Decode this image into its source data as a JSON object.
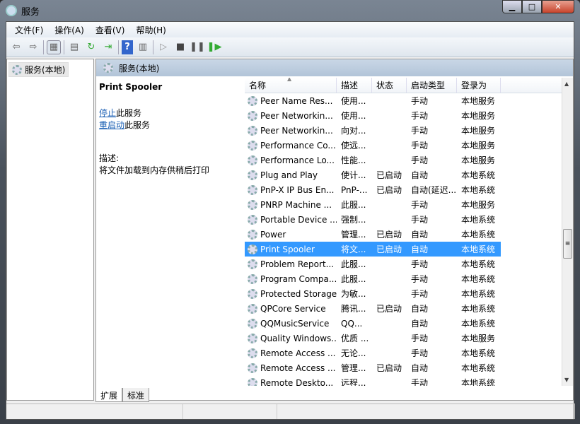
{
  "window": {
    "title": "服务"
  },
  "menu": [
    "文件(F)",
    "操作(A)",
    "查看(V)",
    "帮助(H)"
  ],
  "toolbar": [
    "back-icon",
    "forward-icon",
    "show-hide-tree-icon",
    "properties-icon",
    "refresh-icon",
    "export-icon",
    "help-icon",
    "action-pane-icon",
    "start-icon",
    "stop-icon",
    "pause-icon",
    "restart-icon"
  ],
  "tree": {
    "root": "服务(本地)"
  },
  "pane": {
    "header": "服务(本地)",
    "selected_name": "Print Spooler",
    "stop_link": "停止",
    "stop_suffix": "此服务",
    "restart_link": "重启动",
    "restart_suffix": "此服务",
    "desc_label": "描述:",
    "desc_text": "将文件加载到内存供稍后打印"
  },
  "columns": [
    "名称",
    "描述",
    "状态",
    "启动类型",
    "登录为"
  ],
  "rows": [
    [
      "Peer Name Res...",
      "使用...",
      "",
      "手动",
      "本地服务"
    ],
    [
      "Peer Networkin...",
      "使用...",
      "",
      "手动",
      "本地服务"
    ],
    [
      "Peer Networkin...",
      "向对...",
      "",
      "手动",
      "本地服务"
    ],
    [
      "Performance Co...",
      "使远...",
      "",
      "手动",
      "本地服务"
    ],
    [
      "Performance Lo...",
      "性能...",
      "",
      "手动",
      "本地服务"
    ],
    [
      "Plug and Play",
      "使计...",
      "已启动",
      "自动",
      "本地系统"
    ],
    [
      "PnP-X IP Bus En...",
      "PnP-...",
      "已启动",
      "自动(延迟...",
      "本地系统"
    ],
    [
      "PNRP Machine ...",
      "此服...",
      "",
      "手动",
      "本地服务"
    ],
    [
      "Portable Device ...",
      "强制...",
      "",
      "手动",
      "本地系统"
    ],
    [
      "Power",
      "管理...",
      "已启动",
      "自动",
      "本地系统"
    ],
    [
      "Print Spooler",
      "将文...",
      "已启动",
      "自动",
      "本地系统"
    ],
    [
      "Problem Report...",
      "此服...",
      "",
      "手动",
      "本地系统"
    ],
    [
      "Program Compa...",
      "此服...",
      "",
      "手动",
      "本地系统"
    ],
    [
      "Protected Storage",
      "为敏...",
      "",
      "手动",
      "本地系统"
    ],
    [
      "QPCore Service",
      "腾讯...",
      "已启动",
      "自动",
      "本地系统"
    ],
    [
      "QQMusicService",
      "QQ...",
      "",
      "自动",
      "本地系统"
    ],
    [
      "Quality Windows...",
      "优质 ...",
      "",
      "手动",
      "本地服务"
    ],
    [
      "Remote Access ...",
      "无论...",
      "",
      "手动",
      "本地系统"
    ],
    [
      "Remote Access ...",
      "管理...",
      "已启动",
      "自动",
      "本地系统"
    ],
    [
      "Remote Deskto...",
      "远程...",
      "",
      "手动",
      "本地系统"
    ]
  ],
  "selected_row": 10,
  "tabs": [
    "扩展",
    "标准"
  ],
  "colors": {
    "selection": "#3399ff",
    "link": "#1a5fb4"
  }
}
